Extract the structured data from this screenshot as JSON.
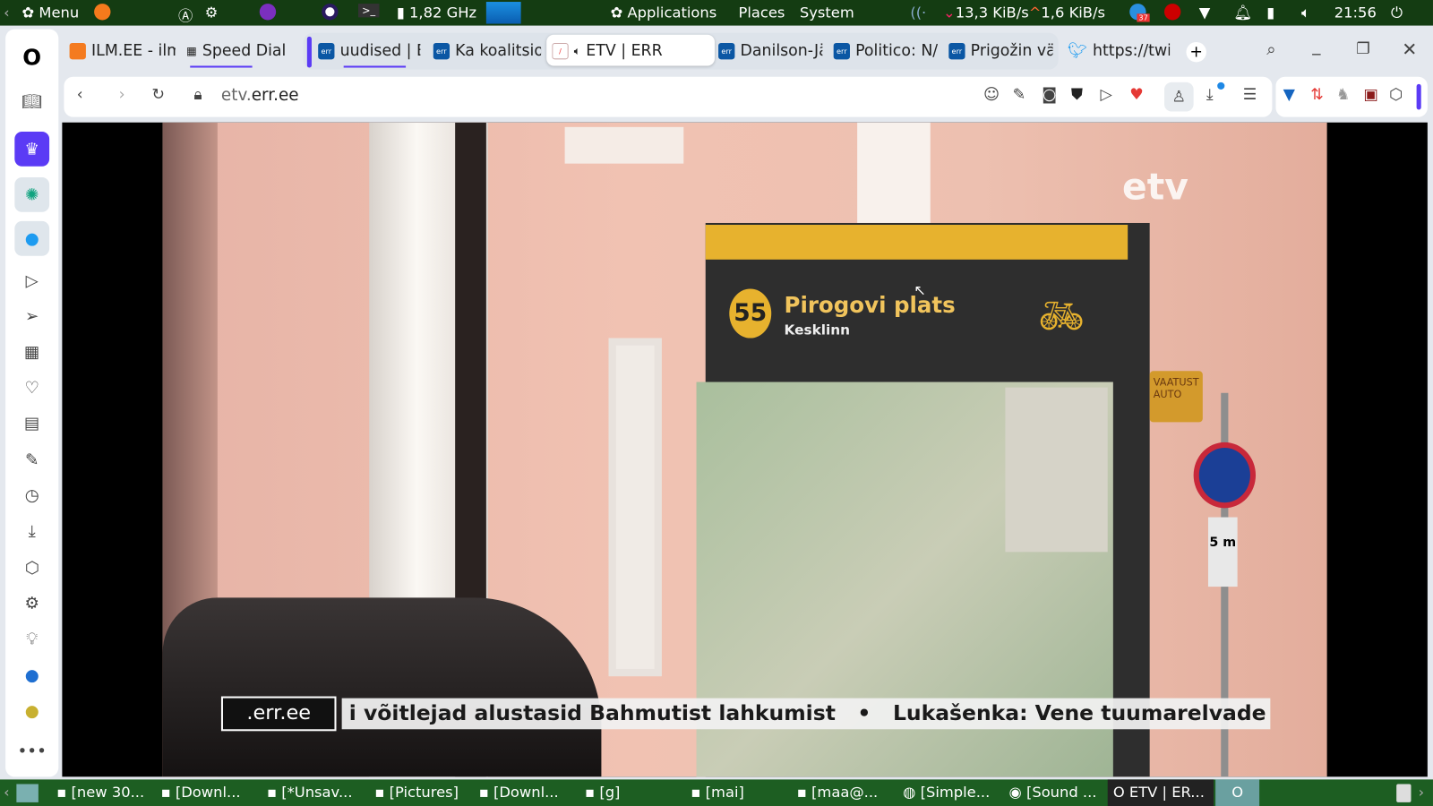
{
  "top_panel": {
    "menu": "Menu",
    "cpu": "1,82 GHz",
    "applications": "Applications",
    "places": "Places",
    "system": "System",
    "net_down": "13,3 KiB/s",
    "net_up": "1,6 KiB/s",
    "clock": "21:56",
    "badge": "37"
  },
  "tabs": [
    {
      "label": "ILM.EE - ilm",
      "favicon": "ilm-icon"
    },
    {
      "label": "Speed Dial",
      "favicon": "grid-icon"
    },
    {
      "label": "uudised | E",
      "favicon": "err-icon"
    },
    {
      "label": "Ka koalitsio",
      "favicon": "err-icon"
    },
    {
      "label": "ETV | ERR",
      "favicon": "etv-icon",
      "active": true,
      "audio": true
    },
    {
      "label": "Danilson-Jä",
      "favicon": "err-icon"
    },
    {
      "label": "Politico: N/",
      "favicon": "err-icon"
    },
    {
      "label": "Prigožin vä",
      "favicon": "err-icon"
    },
    {
      "label": "https://twi",
      "favicon": "twitter-icon"
    }
  ],
  "address": {
    "domain_prefix": "etv.",
    "domain": "err.ee"
  },
  "video": {
    "sign_number": "55",
    "sign_title": "Pirogovi plats",
    "sign_sub": "Kesklinn",
    "sign2": "VAATUST AUTO",
    "logo": "etv",
    "ticker_source": ".err.ee",
    "ticker_text": "i võitlejad alustasid Bahmutist lahkumist   •   Lukašenka: Vene tuumarelvade paig",
    "road_sign": "5 m"
  },
  "taskbar": [
    "[new 30...",
    "[Downl...",
    "[*Unsav...",
    "[Pictures]",
    "[Downl...",
    "[g]",
    "[mai]",
    "[maa@...",
    "[Simple...",
    "[Sound ...",
    "ETV | ER..."
  ],
  "colors": {
    "accent": "#5b3bf5",
    "panel": "#143c12",
    "taskbar": "#1d5e22"
  }
}
